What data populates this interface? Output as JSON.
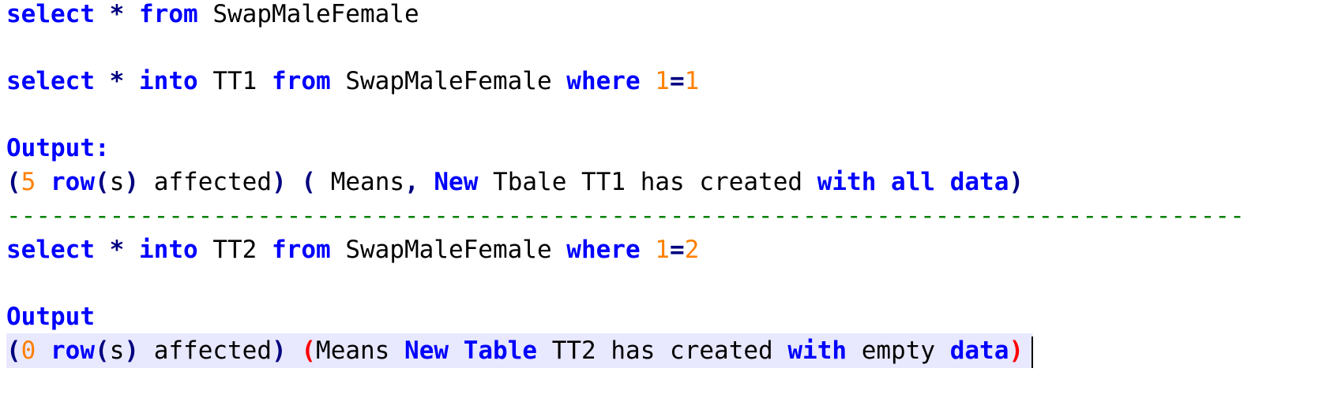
{
  "line1": [
    {
      "t": "select",
      "c": "kw"
    },
    {
      "t": " "
    },
    {
      "t": "*",
      "c": "sym"
    },
    {
      "t": " "
    },
    {
      "t": "from",
      "c": "kw"
    },
    {
      "t": " "
    },
    {
      "t": "SwapMaleFemale",
      "c": "id"
    }
  ],
  "line2": [
    {
      "t": "select",
      "c": "kw"
    },
    {
      "t": " "
    },
    {
      "t": "*",
      "c": "sym"
    },
    {
      "t": " "
    },
    {
      "t": "into",
      "c": "kw"
    },
    {
      "t": " "
    },
    {
      "t": "TT1",
      "c": "id"
    },
    {
      "t": " "
    },
    {
      "t": "from",
      "c": "kw"
    },
    {
      "t": " "
    },
    {
      "t": "SwapMaleFemale",
      "c": "id"
    },
    {
      "t": " "
    },
    {
      "t": "where",
      "c": "kw"
    },
    {
      "t": " "
    },
    {
      "t": "1",
      "c": "num"
    },
    {
      "t": "=",
      "c": "sym"
    },
    {
      "t": "1",
      "c": "num"
    }
  ],
  "line3": [
    {
      "t": "Output:",
      "c": "kw"
    }
  ],
  "line4": [
    {
      "t": "(",
      "c": "sym"
    },
    {
      "t": "5",
      "c": "num"
    },
    {
      "t": " "
    },
    {
      "t": "row",
      "c": "kw"
    },
    {
      "t": "(",
      "c": "sym"
    },
    {
      "t": "s",
      "c": "id"
    },
    {
      "t": ")",
      "c": "sym"
    },
    {
      "t": " "
    },
    {
      "t": "affected",
      "c": "id"
    },
    {
      "t": ")",
      "c": "sym"
    },
    {
      "t": " "
    },
    {
      "t": "(",
      "c": "sym"
    },
    {
      "t": " "
    },
    {
      "t": "Means",
      "c": "id"
    },
    {
      "t": ",",
      "c": "sym"
    },
    {
      "t": " "
    },
    {
      "t": "New",
      "c": "kw"
    },
    {
      "t": " "
    },
    {
      "t": "Tbale",
      "c": "id"
    },
    {
      "t": " "
    },
    {
      "t": "TT1",
      "c": "id"
    },
    {
      "t": " "
    },
    {
      "t": "has",
      "c": "id"
    },
    {
      "t": " "
    },
    {
      "t": "created",
      "c": "id"
    },
    {
      "t": " "
    },
    {
      "t": "with",
      "c": "kw"
    },
    {
      "t": " "
    },
    {
      "t": "all",
      "c": "kw"
    },
    {
      "t": " "
    },
    {
      "t": "data",
      "c": "kw"
    },
    {
      "t": ")",
      "c": "sym"
    }
  ],
  "line5": [
    {
      "t": "------------------------------------------------------------------------------------",
      "c": "comment"
    }
  ],
  "line6": [
    {
      "t": "select",
      "c": "kw"
    },
    {
      "t": " "
    },
    {
      "t": "*",
      "c": "sym"
    },
    {
      "t": " "
    },
    {
      "t": "into",
      "c": "kw"
    },
    {
      "t": " "
    },
    {
      "t": "TT2",
      "c": "id"
    },
    {
      "t": " "
    },
    {
      "t": "from",
      "c": "kw"
    },
    {
      "t": " "
    },
    {
      "t": "SwapMaleFemale",
      "c": "id"
    },
    {
      "t": " "
    },
    {
      "t": "where",
      "c": "kw"
    },
    {
      "t": " "
    },
    {
      "t": "1",
      "c": "num"
    },
    {
      "t": "=",
      "c": "sym"
    },
    {
      "t": "2",
      "c": "num"
    }
  ],
  "line7": [
    {
      "t": "Output",
      "c": "kw"
    }
  ],
  "line8": [
    {
      "t": "(",
      "c": "sym"
    },
    {
      "t": "0",
      "c": "num"
    },
    {
      "t": " "
    },
    {
      "t": "row",
      "c": "kw"
    },
    {
      "t": "(",
      "c": "sym"
    },
    {
      "t": "s",
      "c": "id"
    },
    {
      "t": ")",
      "c": "sym"
    },
    {
      "t": " "
    },
    {
      "t": "affected",
      "c": "id"
    },
    {
      "t": ")",
      "c": "sym"
    },
    {
      "t": " "
    },
    {
      "t": "(",
      "c": "red"
    },
    {
      "t": "Means",
      "c": "id"
    },
    {
      "t": " "
    },
    {
      "t": "New",
      "c": "kw"
    },
    {
      "t": " "
    },
    {
      "t": "Table",
      "c": "kw"
    },
    {
      "t": " "
    },
    {
      "t": "TT2",
      "c": "id"
    },
    {
      "t": " "
    },
    {
      "t": "has",
      "c": "id"
    },
    {
      "t": " "
    },
    {
      "t": "created",
      "c": "id"
    },
    {
      "t": " "
    },
    {
      "t": "with",
      "c": "kw"
    },
    {
      "t": " "
    },
    {
      "t": "empty",
      "c": "id"
    },
    {
      "t": " "
    },
    {
      "t": "data",
      "c": "kw"
    },
    {
      "t": ")",
      "c": "red"
    }
  ]
}
